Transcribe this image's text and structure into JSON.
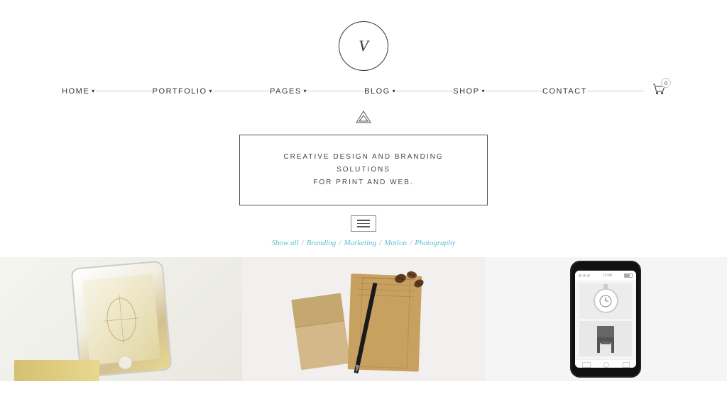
{
  "logo": {
    "symbol": "V",
    "aria": "Brand logo"
  },
  "nav": {
    "items": [
      {
        "label": "HOME",
        "has_dropdown": true
      },
      {
        "label": "PORTFOLIO",
        "has_dropdown": true
      },
      {
        "label": "PAGES",
        "has_dropdown": true
      },
      {
        "label": "BLOG",
        "has_dropdown": true
      },
      {
        "label": "SHOP",
        "has_dropdown": true
      },
      {
        "label": "CONTACT",
        "has_dropdown": false
      }
    ],
    "cart_count": "0"
  },
  "hero": {
    "line1": "CREATIVE DESIGN AND BRANDING SOLUTIONS",
    "line2": "FOR PRINT AND WEB."
  },
  "filter": {
    "show_all": "Show all",
    "separator": "/",
    "categories": [
      "Branding",
      "Marketing",
      "Motion",
      "Photography"
    ]
  },
  "portfolio": {
    "items": [
      {
        "id": "phone-gold",
        "alt": "Gold phone mockup"
      },
      {
        "id": "notebook",
        "alt": "Notebook and coffee beans"
      },
      {
        "id": "watch-app",
        "alt": "Watch app on phone"
      }
    ]
  }
}
